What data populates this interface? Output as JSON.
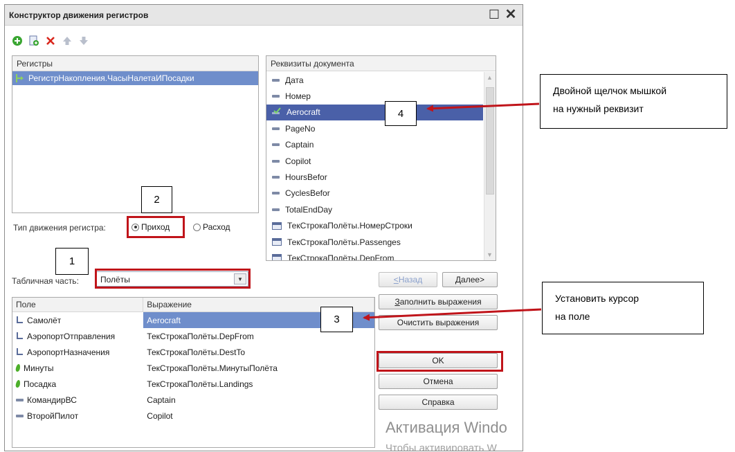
{
  "window": {
    "title": "Конструктор движения регистров"
  },
  "registers": {
    "header": "Регистры",
    "items": [
      "РегистрНакопления.ЧасыНалетаИПосадки"
    ]
  },
  "attributes": {
    "header": "Реквизиты документа",
    "items": [
      {
        "label": "Дата",
        "icon": "dash"
      },
      {
        "label": "Номер",
        "icon": "dash"
      },
      {
        "label": "Aerocraft",
        "icon": "check",
        "selected": true
      },
      {
        "label": "PageNo",
        "icon": "dash"
      },
      {
        "label": "Captain",
        "icon": "dash"
      },
      {
        "label": "Copilot",
        "icon": "dash"
      },
      {
        "label": "HoursBefor",
        "icon": "dash"
      },
      {
        "label": "CyclesBefor",
        "icon": "dash"
      },
      {
        "label": "TotalEndDay",
        "icon": "dash"
      },
      {
        "label": "ТекСтрокаПолёты.НомерСтроки",
        "icon": "table"
      },
      {
        "label": "ТекСтрокаПолёты.Passenges",
        "icon": "table"
      },
      {
        "label": "ТекСтрокаПолёты.DepFrom",
        "icon": "table"
      }
    ]
  },
  "movement": {
    "label": "Тип движения регистра:",
    "options": [
      "Приход",
      "Расход"
    ],
    "selected": "Приход"
  },
  "tabular": {
    "label": "Табличная часть:",
    "value": "Полёты"
  },
  "buttons": {
    "back": "<Назад",
    "next": "Далее>",
    "fill": "Заполнить выражения",
    "clear": "Очистить выражения",
    "ok": "OK",
    "cancel": "Отмена",
    "help": "Справка"
  },
  "fields_table": {
    "columns": [
      "Поле",
      "Выражение"
    ],
    "rows": [
      {
        "field": "Самолёт",
        "expr": "Aerocraft",
        "icon": "dimension",
        "selected": true
      },
      {
        "field": "АэропортОтправления",
        "expr": "ТекСтрокаПолёты.DepFrom",
        "icon": "dimension"
      },
      {
        "field": "АэропортНазначения",
        "expr": "ТекСтрокаПолёты.DestTo",
        "icon": "dimension"
      },
      {
        "field": "Минуты",
        "expr": "ТекСтрокаПолёты.МинутыПолёта",
        "icon": "resource"
      },
      {
        "field": "Посадка",
        "expr": "ТекСтрокаПолёты.Landings",
        "icon": "resource"
      },
      {
        "field": "КомандирВС",
        "expr": "Captain",
        "icon": "attribute"
      },
      {
        "field": "ВторойПилот",
        "expr": "Copilot",
        "icon": "attribute"
      }
    ]
  },
  "watermark": {
    "line1": "Активация Windo",
    "line2": "Чтобы активировать W"
  },
  "annotations": {
    "markers": [
      "1",
      "2",
      "3",
      "4"
    ],
    "callout_double_click": [
      "Двойной щелчок мышкой",
      "на нужный реквизит"
    ],
    "callout_cursor": [
      "Установить курсор",
      "на поле"
    ],
    "color": "#c0141a"
  }
}
